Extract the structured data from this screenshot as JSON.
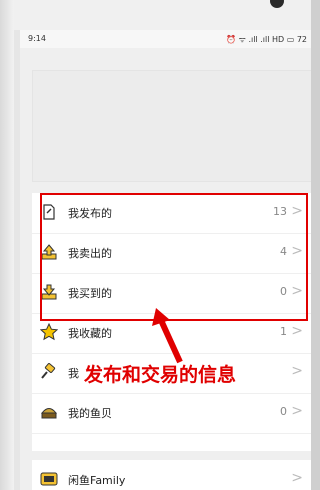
{
  "status_bar": {
    "time": "9:14",
    "right": "⏰ ᯤ .ıll .ıll HD ▭ 72"
  },
  "menu": [
    {
      "label": "我发布的",
      "count": "13",
      "icon": "publish-icon"
    },
    {
      "label": "我卖出的",
      "count": "4",
      "icon": "sold-icon"
    },
    {
      "label": "我买到的",
      "count": "0",
      "icon": "bought-icon"
    },
    {
      "label": "我收藏的",
      "count": "1",
      "icon": "star-icon"
    },
    {
      "label": "我",
      "count": "",
      "icon": "auction-icon"
    },
    {
      "label": "我的鱼贝",
      "count": "0",
      "icon": "fish-coin-icon"
    }
  ],
  "family": {
    "label": "闲鱼Family",
    "icon": "family-icon"
  },
  "annotation": "发布和交易的信息",
  "colors": {
    "highlight": "#e00000",
    "star": "#f5c400",
    "icon_yellow": "#f3c233"
  }
}
